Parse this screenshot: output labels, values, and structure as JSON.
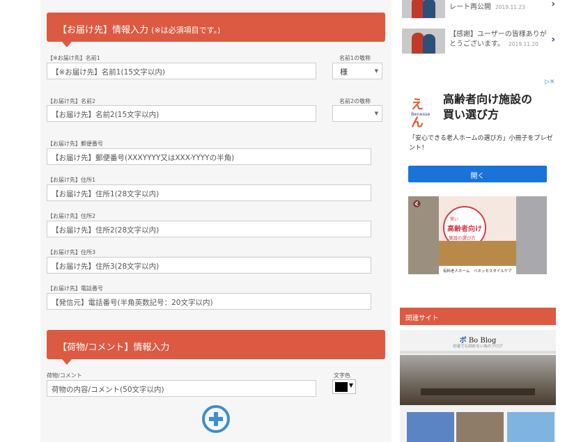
{
  "form": {
    "delivery_section": {
      "title": "【お届け先】情報入力",
      "note": "(※は必須項目です。)"
    },
    "fields": {
      "name1": {
        "label": "【※お届け先】名前1",
        "placeholder": "【※お届け先】名前1(15文字以内)"
      },
      "honorific1": {
        "label": "名前1の敬称",
        "value": "様"
      },
      "name2": {
        "label": "【お届け先】名前2",
        "placeholder": "【お届け先】名前2(15文字以内)"
      },
      "honorific2": {
        "label": "名前2の敬称",
        "value": ""
      },
      "postal": {
        "label": "【お届け先】郵便番号",
        "placeholder": "【お届け先】郵便番号(XXXYYYY又はXXX-YYYYの半角)"
      },
      "address1": {
        "label": "【お届け先】住所1",
        "placeholder": "【お届け先】住所1(28文字以内)"
      },
      "address2": {
        "label": "【お届け先】住所2",
        "placeholder": "【お届け先】住所2(28文字以内)"
      },
      "address3": {
        "label": "【お届け先】住所3",
        "placeholder": "【お届け先】住所3(28文字以内)"
      },
      "phone": {
        "label": "【お届け先】電話番号",
        "placeholder": "【発信元】電話番号(半角英数記号：20文字以内)"
      }
    },
    "package_section": {
      "title": "【荷物/コメント】情報入力"
    },
    "comment": {
      "label": "荷物/コメント",
      "placeholder": "荷物の内容/コメント(50文字以内)"
    },
    "text_color": {
      "label": "文字色",
      "value": "#000000"
    },
    "add_icon": "plus-circle-icon"
  },
  "sidebar": {
    "news": [
      {
        "text": "レート再公開",
        "date": "2019.11.23"
      },
      {
        "text": "【感謝】ユーザーの皆様ありがとうございます。",
        "date": "2019.11.20"
      }
    ],
    "ad": {
      "logo_mark": "えん",
      "logo_sub": "Benesse",
      "title_line1": "高齢者向け施設の",
      "title_line2": "買い選び方",
      "desc": "「安心できる老人ホームの選び方」小冊子をプレゼント！",
      "open_label": "開く",
      "video_badge_top": "賢い",
      "video_badge_main": "高齢者向け",
      "video_badge_bottom": "施設の選び方",
      "video_footer": "有料老人ホーム　ベネッセスタイルケア"
    },
    "related": {
      "header": "関連サイト",
      "blog_title_mark": "ボ",
      "blog_title": "Bo Blog",
      "blog_sub": "初者でも訓めない為のブログ"
    }
  },
  "colors": {
    "accent": "#dd5a42",
    "link_blue": "#3c8ed0",
    "ad_button": "#1a73d9"
  }
}
